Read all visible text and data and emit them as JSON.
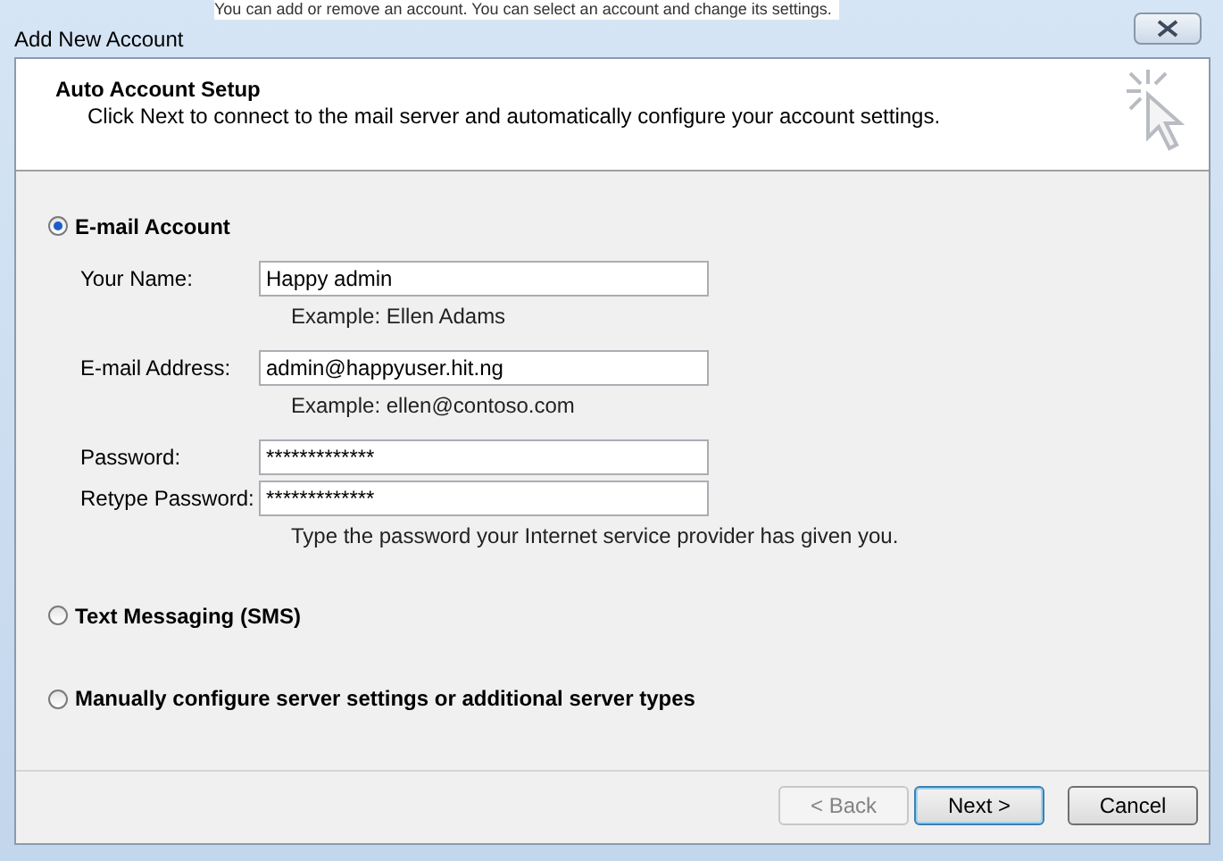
{
  "background_text": "You can add or remove an account. You can select an account and change its settings.",
  "window": {
    "title": "Add New Account"
  },
  "header": {
    "title": "Auto Account Setup",
    "description": "Click Next to connect to the mail server and automatically configure your account settings."
  },
  "options": [
    {
      "label": "E-mail Account",
      "selected": true,
      "fields": [
        {
          "label": "Your Name:",
          "value": "Happy admin",
          "hint": "Example: Ellen Adams"
        },
        {
          "label": "E-mail Address:",
          "value": "admin@happyuser.hit.ng",
          "hint": "Example: ellen@contoso.com"
        },
        {
          "label": "Password:",
          "value": "*************"
        },
        {
          "label": "Retype Password:",
          "value": "*************",
          "hint": "Type the password your Internet service provider has given you."
        }
      ]
    },
    {
      "label": "Text Messaging (SMS)",
      "selected": false
    },
    {
      "label": "Manually configure server settings or additional server types",
      "selected": false
    }
  ],
  "buttons": [
    {
      "label": "< Back",
      "disabled": true,
      "default": false
    },
    {
      "label": "Next >",
      "disabled": false,
      "default": true
    },
    {
      "label": "Cancel",
      "disabled": false,
      "default": false
    }
  ]
}
